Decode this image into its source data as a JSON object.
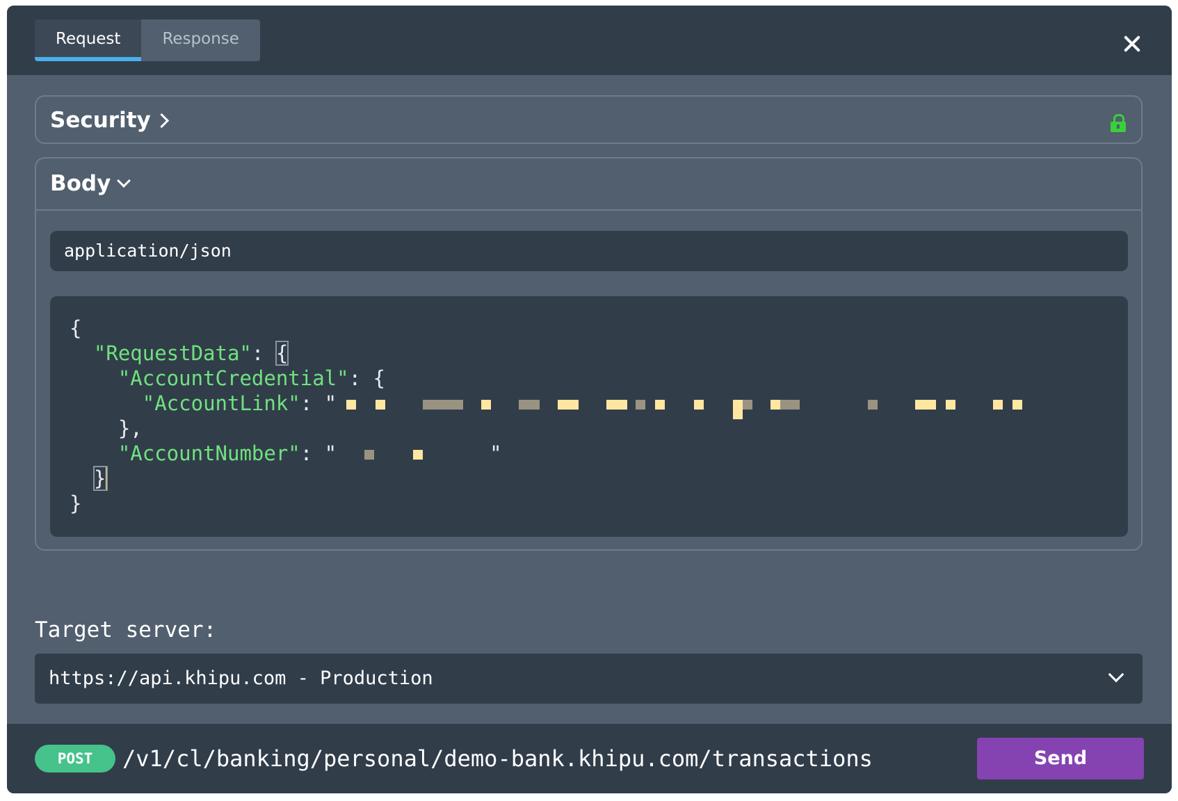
{
  "tabs": [
    {
      "label": "Request",
      "active": true
    },
    {
      "label": "Response",
      "active": false
    }
  ],
  "security": {
    "title": "Security",
    "lock_icon": "lock-icon-unlocked",
    "lock_color": "#3ad03a"
  },
  "body": {
    "title": "Body",
    "content_type": "application/json",
    "code": {
      "open": "{",
      "key_request_data": "\"RequestData\"",
      "key_account_credential": "\"AccountCredential\"",
      "key_account_link": "\"AccountLink\"",
      "key_account_number": "\"AccountNumber\"",
      "close_credential": "},",
      "close_inner": "}",
      "close": "}"
    }
  },
  "target": {
    "label": "Target server:",
    "selected": "https://api.khipu.com - Production"
  },
  "footer": {
    "method": "POST",
    "path": "/v1/cl/banking/personal/demo-bank.khipu.com/transactions",
    "send_label": "Send"
  },
  "colors": {
    "accent_tab": "#46b0ea",
    "method_badge": "#45c38a",
    "send_button": "#8543b2",
    "json_key": "#6fe27f"
  }
}
